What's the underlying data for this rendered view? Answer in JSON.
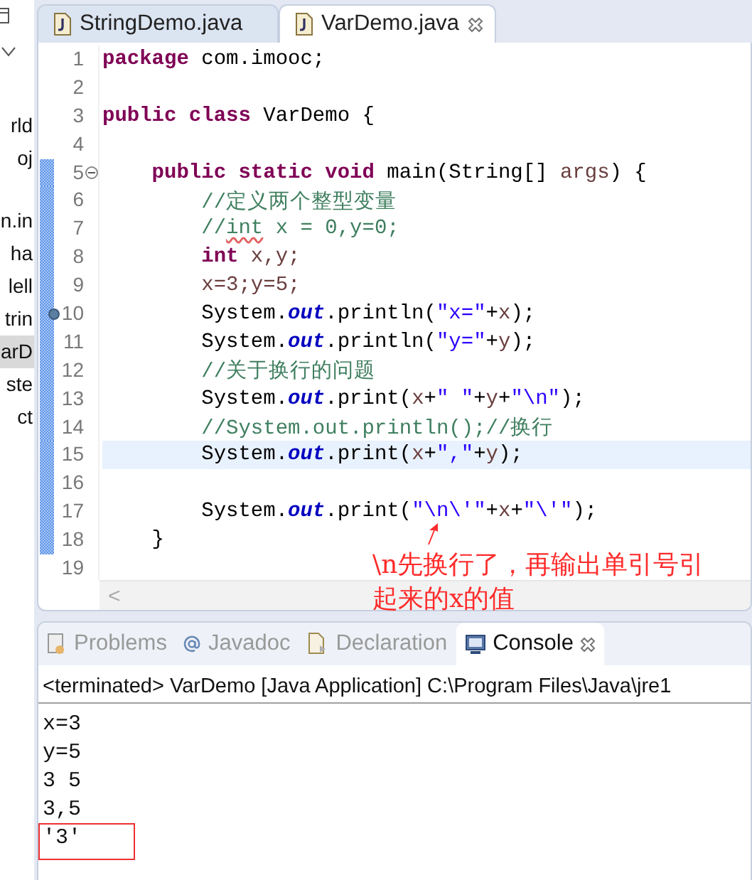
{
  "package_explorer": {
    "items": [
      {
        "label": "rld",
        "selected": false
      },
      {
        "label": "oj",
        "selected": false
      },
      {
        "label": "n.in",
        "selected": false
      },
      {
        "label": "ha",
        "selected": false
      },
      {
        "label": "lell",
        "selected": false
      },
      {
        "label": "trin",
        "selected": false
      },
      {
        "label": "arD",
        "selected": true
      },
      {
        "label": "ste",
        "selected": false
      },
      {
        "label": "ct",
        "selected": false
      }
    ]
  },
  "editor": {
    "tabs": [
      {
        "label": "StringDemo.java",
        "selected": false
      },
      {
        "label": "VarDemo.java",
        "selected": true
      }
    ],
    "lines": [
      {
        "number": "1",
        "changed": false,
        "current": false,
        "collapsible": false,
        "annotated": false,
        "tokens": [
          {
            "kind": "keyword",
            "text": "package"
          },
          {
            "kind": "plain",
            "text": " com.imooc;"
          }
        ]
      },
      {
        "number": "2",
        "changed": false,
        "current": false,
        "collapsible": false,
        "annotated": false
      },
      {
        "number": "3",
        "changed": false,
        "current": false,
        "collapsible": false,
        "annotated": false,
        "tokens": [
          {
            "kind": "keyword",
            "text": "public class"
          },
          {
            "kind": "plain",
            "text": " VarDemo {"
          }
        ]
      },
      {
        "number": "4",
        "changed": false,
        "current": false,
        "collapsible": false,
        "annotated": false
      },
      {
        "number": "5",
        "changed": true,
        "current": false,
        "collapsible": true,
        "annotated": false,
        "tokens": [
          {
            "kind": "keyword",
            "text": "    public static void"
          },
          {
            "kind": "plain",
            "text": " main(String[] "
          },
          {
            "kind": "variable",
            "text": "args"
          },
          {
            "kind": "plain",
            "text": ") {"
          }
        ]
      },
      {
        "number": "6",
        "changed": true,
        "current": false,
        "collapsible": false,
        "annotated": false,
        "tokens": [
          {
            "kind": "comment",
            "text": "        //定义两个整型变量"
          }
        ]
      },
      {
        "number": "7",
        "changed": true,
        "current": false,
        "collapsible": false,
        "annotated": false,
        "tokens": [
          {
            "kind": "comment",
            "text": "        //"
          },
          {
            "kind": "misspelled",
            "text": "int"
          },
          {
            "kind": "comment",
            "text": " x = 0,y=0;"
          }
        ]
      },
      {
        "number": "8",
        "changed": true,
        "current": false,
        "collapsible": false,
        "annotated": false,
        "tokens": [
          {
            "kind": "keyword",
            "text": "        int"
          },
          {
            "kind": "variable",
            "text": " x,y;"
          }
        ]
      },
      {
        "number": "9",
        "changed": true,
        "current": false,
        "collapsible": false,
        "annotated": false,
        "tokens": [
          {
            "kind": "variable",
            "text": "        x=3;y=5;"
          }
        ]
      },
      {
        "number": "10",
        "changed": true,
        "current": false,
        "collapsible": false,
        "annotated": true,
        "tokens": [
          {
            "kind": "plain",
            "text": "        System."
          },
          {
            "kind": "field",
            "text": "out"
          },
          {
            "kind": "plain",
            "text": ".println("
          },
          {
            "kind": "string",
            "text": "\"x=\""
          },
          {
            "kind": "plain",
            "text": "+"
          },
          {
            "kind": "variable",
            "text": "x"
          },
          {
            "kind": "plain",
            "text": ");"
          }
        ]
      },
      {
        "number": "11",
        "changed": true,
        "current": false,
        "collapsible": false,
        "annotated": false,
        "tokens": [
          {
            "kind": "plain",
            "text": "        System."
          },
          {
            "kind": "field",
            "text": "out"
          },
          {
            "kind": "plain",
            "text": ".println("
          },
          {
            "kind": "string",
            "text": "\"y=\""
          },
          {
            "kind": "plain",
            "text": "+"
          },
          {
            "kind": "variable",
            "text": "y"
          },
          {
            "kind": "plain",
            "text": ");"
          }
        ]
      },
      {
        "number": "12",
        "changed": true,
        "current": false,
        "collapsible": false,
        "annotated": false,
        "tokens": [
          {
            "kind": "comment",
            "text": "        //关于换行的问题"
          }
        ]
      },
      {
        "number": "13",
        "changed": true,
        "current": false,
        "collapsible": false,
        "annotated": false,
        "tokens": [
          {
            "kind": "plain",
            "text": "        System."
          },
          {
            "kind": "field",
            "text": "out"
          },
          {
            "kind": "plain",
            "text": ".print("
          },
          {
            "kind": "variable",
            "text": "x"
          },
          {
            "kind": "plain",
            "text": "+"
          },
          {
            "kind": "string",
            "text": "\" \""
          },
          {
            "kind": "plain",
            "text": "+"
          },
          {
            "kind": "variable",
            "text": "y"
          },
          {
            "kind": "plain",
            "text": "+"
          },
          {
            "kind": "string",
            "text": "\"\\n\""
          },
          {
            "kind": "plain",
            "text": ");"
          }
        ]
      },
      {
        "number": "14",
        "changed": true,
        "current": false,
        "collapsible": false,
        "annotated": false,
        "tokens": [
          {
            "kind": "comment",
            "text": "        //System.out.println();//换行"
          }
        ]
      },
      {
        "number": "15",
        "changed": true,
        "current": true,
        "collapsible": false,
        "annotated": false,
        "tokens": [
          {
            "kind": "plain",
            "text": "        System."
          },
          {
            "kind": "field",
            "text": "out"
          },
          {
            "kind": "plain",
            "text": ".print("
          },
          {
            "kind": "variable",
            "text": "x"
          },
          {
            "kind": "plain",
            "text": "+"
          },
          {
            "kind": "string",
            "text": "\",\""
          },
          {
            "kind": "plain",
            "text": "+"
          },
          {
            "kind": "variable",
            "text": "y"
          },
          {
            "kind": "plain",
            "text": ");"
          }
        ]
      },
      {
        "number": "16",
        "changed": true,
        "current": false,
        "collapsible": false,
        "annotated": false
      },
      {
        "number": "17",
        "changed": true,
        "current": false,
        "collapsible": false,
        "annotated": false,
        "tokens": [
          {
            "kind": "plain",
            "text": "        System."
          },
          {
            "kind": "field",
            "text": "out"
          },
          {
            "kind": "plain",
            "text": ".print("
          },
          {
            "kind": "string",
            "text": "\"\\n\\'\""
          },
          {
            "kind": "plain",
            "text": "+"
          },
          {
            "kind": "variable",
            "text": "x"
          },
          {
            "kind": "plain",
            "text": "+"
          },
          {
            "kind": "string",
            "text": "\"\\'\""
          },
          {
            "kind": "plain",
            "text": ");"
          }
        ]
      },
      {
        "number": "18",
        "changed": true,
        "current": false,
        "collapsible": false,
        "annotated": false,
        "tokens": [
          {
            "kind": "plain",
            "text": "    }"
          }
        ]
      },
      {
        "number": "19",
        "changed": false,
        "current": false,
        "collapsible": false,
        "annotated": false
      }
    ],
    "scroll_left": "<"
  },
  "annotation": {
    "text": "\\n先换行了，再输出单引号引起来的x的值"
  },
  "bottom_panel": {
    "tabs": [
      {
        "label": "Problems",
        "kind": "problems",
        "selected": false
      },
      {
        "label": "Javadoc",
        "kind": "javadoc",
        "selected": false
      },
      {
        "label": "Declaration",
        "kind": "declaration",
        "selected": false
      },
      {
        "label": "Console",
        "kind": "console",
        "selected": true
      }
    ],
    "console": {
      "header": "<terminated> VarDemo [Java Application] C:\\Program Files\\Java\\jre1",
      "output": [
        {
          "text": "x=3",
          "boxed": false
        },
        {
          "text": "y=5",
          "boxed": false
        },
        {
          "text": "3 5",
          "boxed": false
        },
        {
          "text": "3,5",
          "boxed": false
        },
        {
          "text": "'3'",
          "boxed": true
        }
      ]
    }
  }
}
